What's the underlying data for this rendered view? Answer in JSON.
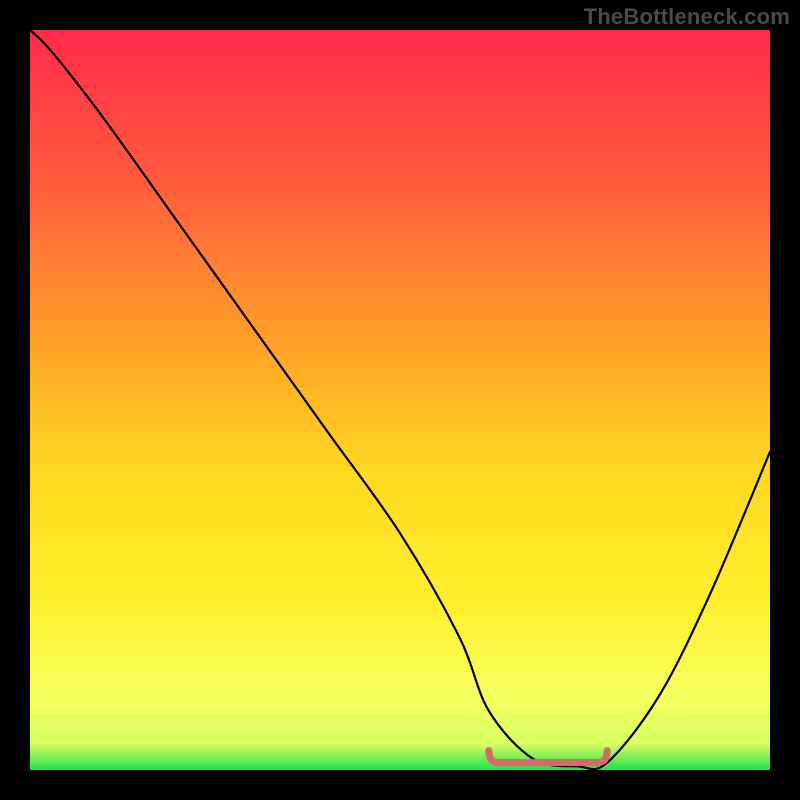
{
  "watermark": "TheBottleneck.com",
  "chart_data": {
    "type": "line",
    "title": "",
    "xlabel": "",
    "ylabel": "",
    "xlim": [
      0,
      100
    ],
    "ylim": [
      0,
      100
    ],
    "gradient_stops": [
      {
        "offset": 0.0,
        "color": "#ff2a4a"
      },
      {
        "offset": 0.2,
        "color": "#ff5a3c"
      },
      {
        "offset": 0.4,
        "color": "#ff9a2a"
      },
      {
        "offset": 0.6,
        "color": "#ffd820"
      },
      {
        "offset": 0.78,
        "color": "#fff030"
      },
      {
        "offset": 0.9,
        "color": "#f7ff60"
      },
      {
        "offset": 0.965,
        "color": "#d8ff60"
      },
      {
        "offset": 1.0,
        "color": "#20e050"
      }
    ],
    "series": [
      {
        "name": "bottleneck-curve",
        "x": [
          0,
          3,
          10,
          20,
          30,
          40,
          50,
          58,
          62,
          68,
          74,
          78,
          85,
          92,
          100
        ],
        "values": [
          100,
          97,
          88,
          74,
          60,
          46,
          32,
          18,
          8,
          1.5,
          0.5,
          1.0,
          10,
          24,
          43
        ]
      }
    ],
    "optimal_range": {
      "x_start": 62,
      "x_end": 78,
      "y": 1.0
    },
    "marker_color": "#d46a6a",
    "marker_stroke_width": 7
  }
}
